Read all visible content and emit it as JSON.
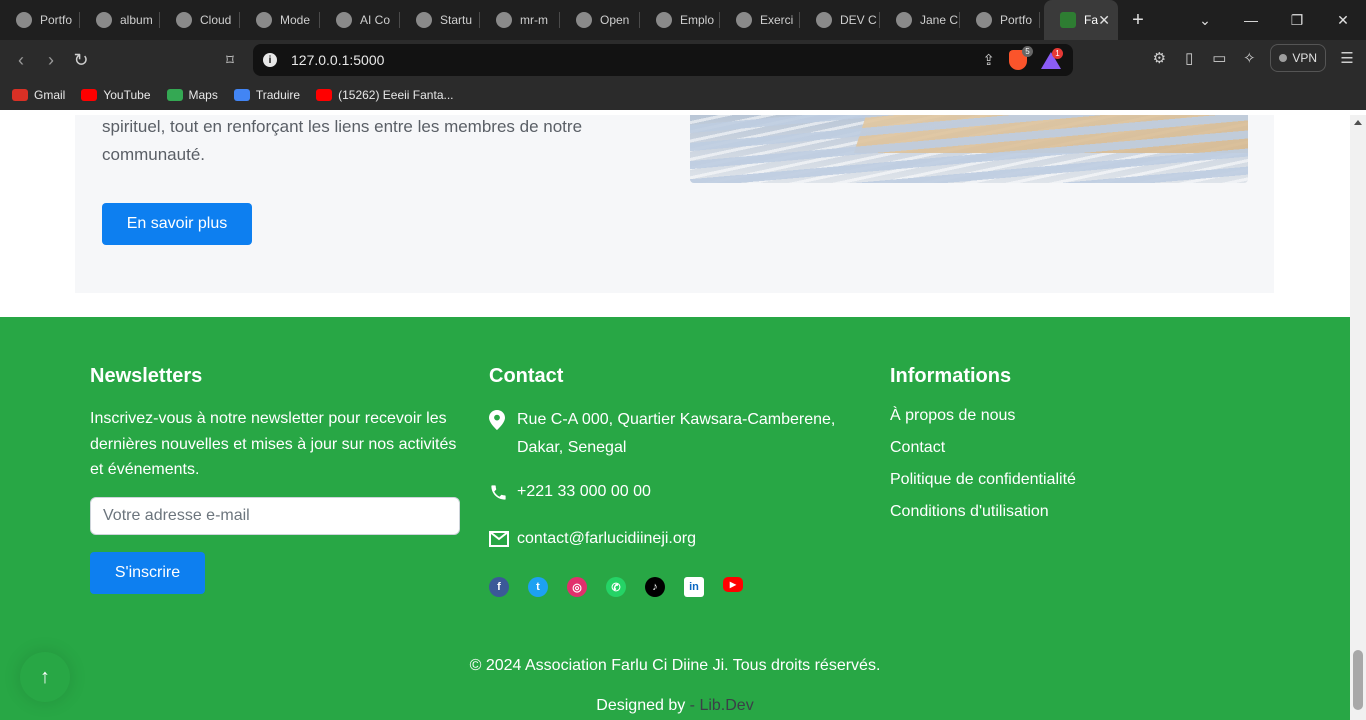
{
  "browser": {
    "tabs": [
      {
        "title": "Portfo",
        "icon": "portfolio-icon"
      },
      {
        "title": "album",
        "icon": "google-icon"
      },
      {
        "title": "Cloud",
        "icon": "mongodb-icon"
      },
      {
        "title": "Mode",
        "icon": "model-icon"
      },
      {
        "title": "AI Co",
        "icon": "ai-icon"
      },
      {
        "title": "Startu",
        "icon": "startup-icon"
      },
      {
        "title": "mr-m",
        "icon": "github-icon"
      },
      {
        "title": "Open",
        "icon": "github-icon"
      },
      {
        "title": "Emplo",
        "icon": "info-icon"
      },
      {
        "title": "Exerci",
        "icon": "exercise-icon"
      },
      {
        "title": "DEV C",
        "icon": "dev-icon"
      },
      {
        "title": "Jane C",
        "icon": "jane-icon"
      },
      {
        "title": "Portfo",
        "icon": "globe-icon"
      }
    ],
    "active_tab": {
      "title": "Fa",
      "close": "✕"
    },
    "new_tab": "+",
    "url": "127.0.0.1:5000",
    "brave_badge": "5",
    "rewards_badge": "1",
    "vpn_label": "VPN",
    "bookmarks": [
      {
        "label": "Gmail",
        "color": "#d93025"
      },
      {
        "label": "YouTube",
        "color": "#ff0000"
      },
      {
        "label": "Maps",
        "color": "#34a853"
      },
      {
        "label": "Traduire",
        "color": "#4285f4"
      },
      {
        "label": "(15262) Eeeii Fanta...",
        "color": "#ff0000"
      }
    ]
  },
  "section": {
    "text": "spirituel, tout en renforçant les liens entre les membres de notre communauté.",
    "button": "En savoir plus"
  },
  "footer": {
    "newsletter": {
      "title": "Newsletters",
      "text": "Inscrivez-vous à notre newsletter pour recevoir les dernières nouvelles et mises à jour sur nos activités et événements.",
      "placeholder": "Votre adresse e-mail",
      "button": "S'inscrire"
    },
    "contact": {
      "title": "Contact",
      "address": "Rue C-A 000, Quartier Kawsara-Camberene, Dakar, Senegal",
      "phone": "+221 33 000 00 00",
      "email": "contact@farlucidiineji.org",
      "socials": [
        {
          "name": "facebook-icon",
          "color": "#3b5998",
          "glyph": "f"
        },
        {
          "name": "twitter-icon",
          "color": "#1da1f2",
          "glyph": "t"
        },
        {
          "name": "instagram-icon",
          "color": "#e1306c",
          "glyph": "◎"
        },
        {
          "name": "whatsapp-icon",
          "color": "#25d366",
          "glyph": "✆"
        },
        {
          "name": "tiktok-icon",
          "color": "#000000",
          "glyph": "♪"
        },
        {
          "name": "linkedin-icon",
          "color": "#0a66c2",
          "glyph": "in"
        },
        {
          "name": "youtube-icon",
          "color": "#ff0000",
          "glyph": "▶"
        }
      ]
    },
    "info": {
      "title": "Informations",
      "links": [
        "À propos de nous",
        "Contact",
        "Politique de confidentialité",
        "Conditions d'utilisation"
      ]
    },
    "copyright": "© 2024 Association Farlu Ci Diine Ji. Tous droits réservés.",
    "designed_by": "Designed by",
    "designed_sep": " - ",
    "designer": "Lib.Dev"
  },
  "colors": {
    "footer_bg": "#28a745",
    "primary_button": "#0d7ff0"
  },
  "back_to_top": "↑"
}
